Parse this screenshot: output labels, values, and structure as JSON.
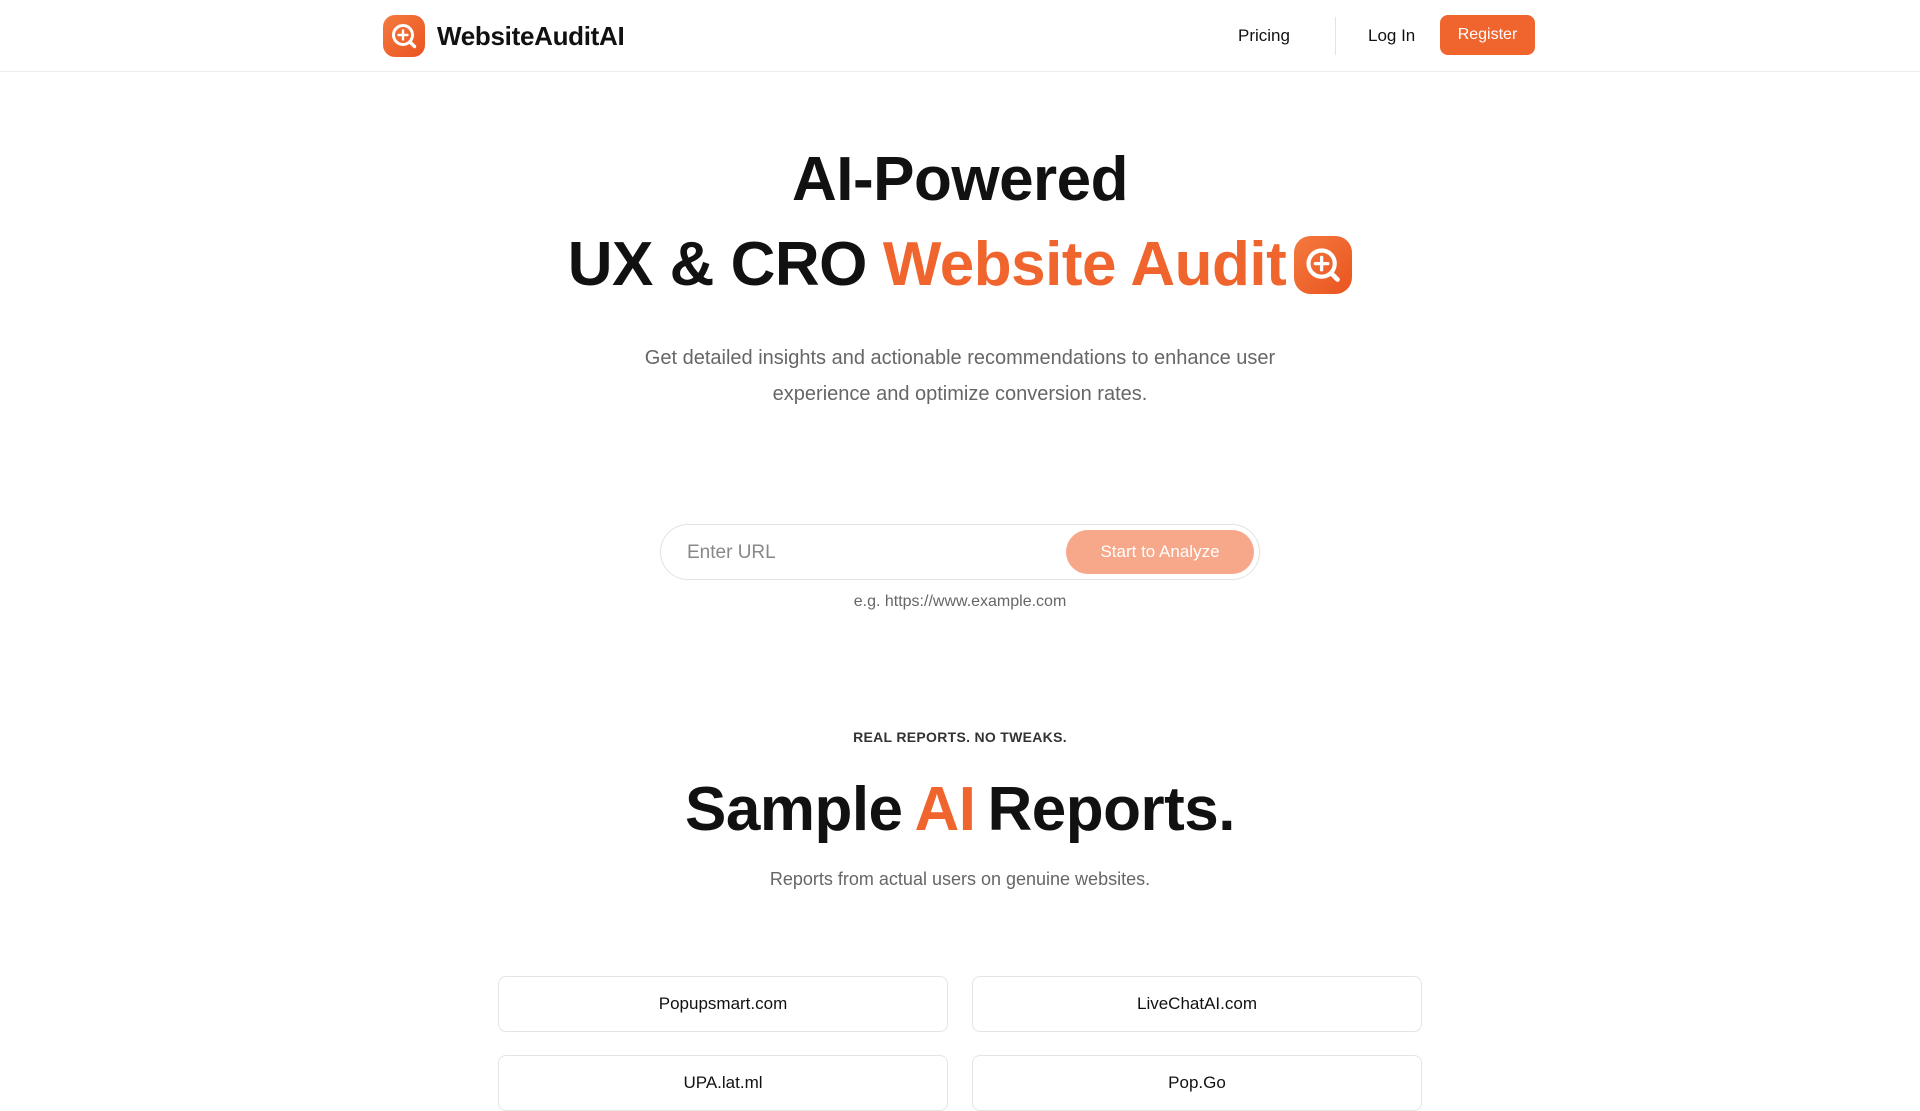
{
  "brand": {
    "name": "WebsiteAuditAI",
    "logo_icon": "magnifier-plus-icon",
    "accent_color": "#f0642d"
  },
  "nav": {
    "pricing": "Pricing",
    "login": "Log In",
    "register": "Register"
  },
  "hero": {
    "line1": "AI-Powered",
    "line2_dark": "UX & CRO",
    "line2_accent": "Website Audit",
    "icon": "magnifier-plus-icon",
    "subtitle": "Get detailed insights and actionable recommendations to enhance user experience and optimize conversion rates."
  },
  "analyzer": {
    "url_placeholder": "Enter URL",
    "url_value": "",
    "button_label": "Start to Analyze",
    "button_color": "#f7a88a",
    "hint": "e.g. https://www.example.com"
  },
  "samples": {
    "eyebrow": "REAL REPORTS. NO TWEAKS.",
    "title_part1": "Sample",
    "title_accent": "AI",
    "title_part2": "Reports.",
    "subtitle": "Reports from actual users on genuine websites.",
    "reports": [
      {
        "label": "Popupsmart.com"
      },
      {
        "label": "LiveChatAI.com"
      },
      {
        "label": "UPA.lat.ml"
      },
      {
        "label": "Pop.Go"
      }
    ]
  }
}
